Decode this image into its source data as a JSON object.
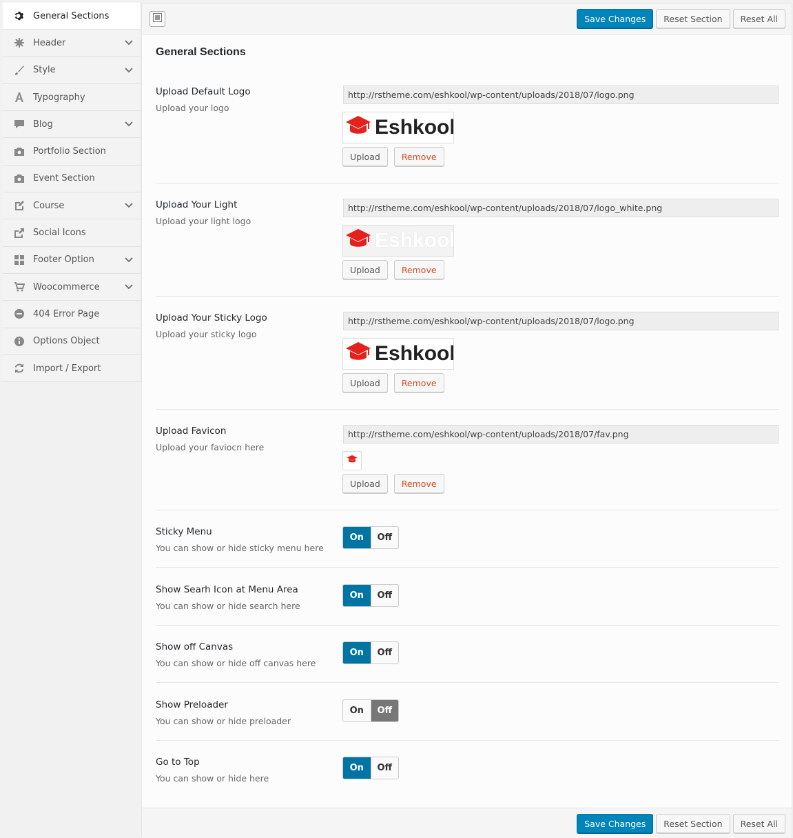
{
  "sidebar": {
    "items": [
      {
        "label": "General Sections",
        "icon": "gear-icon"
      },
      {
        "label": "Header",
        "icon": "cog-icon"
      },
      {
        "label": "Style",
        "icon": "brush-icon"
      },
      {
        "label": "Typography",
        "icon": "font-icon"
      },
      {
        "label": "Blog",
        "icon": "comment-icon"
      },
      {
        "label": "Portfolio Section",
        "icon": "camera-icon"
      },
      {
        "label": "Event Section",
        "icon": "camera-icon"
      },
      {
        "label": "Course",
        "icon": "edit-icon"
      },
      {
        "label": "Social Icons",
        "icon": "share-icon"
      },
      {
        "label": "Footer Option",
        "icon": "grid-icon"
      },
      {
        "label": "Woocommerce",
        "icon": "cart-icon"
      },
      {
        "label": "404 Error Page",
        "icon": "minus-circle-icon"
      },
      {
        "label": "Options Object",
        "icon": "info-icon"
      },
      {
        "label": "Import / Export",
        "icon": "refresh-icon"
      }
    ]
  },
  "toolbar": {
    "save_label": "Save Changes",
    "reset_section_label": "Reset Section",
    "reset_all_label": "Reset All"
  },
  "main": {
    "title": "General Sections",
    "uploads": [
      {
        "label": "Upload Default Logo",
        "desc": "Upload your logo",
        "url": "http://rstheme.com/eshkool/wp-content/uploads/2018/07/logo.png",
        "preview": "Eshkool",
        "variant": "dark-text"
      },
      {
        "label": "Upload Your Light",
        "desc": "Upload your light logo",
        "url": "http://rstheme.com/eshkool/wp-content/uploads/2018/07/logo_white.png",
        "preview": "Eshkool",
        "variant": "light-text"
      },
      {
        "label": "Upload Your Sticky Logo",
        "desc": "Upload your sticky logo",
        "url": "http://rstheme.com/eshkool/wp-content/uploads/2018/07/logo.png",
        "preview": "Eshkool",
        "variant": "dark-text"
      },
      {
        "label": "Upload Favicon",
        "desc": "Upload your faviocn here",
        "url": "http://rstheme.com/eshkool/wp-content/uploads/2018/07/fav.png",
        "preview": "",
        "variant": "favicon"
      }
    ],
    "upload_label": "Upload",
    "remove_label": "Remove",
    "switches": [
      {
        "label": "Sticky Menu",
        "desc": "You can show or hide sticky menu here",
        "value": "On"
      },
      {
        "label": "Show Searh Icon at Menu Area",
        "desc": "You can show or hide search here",
        "value": "On"
      },
      {
        "label": "Show off Canvas",
        "desc": "You can show or hide off canvas here",
        "value": "On"
      },
      {
        "label": "Show Preloader",
        "desc": "You can show or hide preloader",
        "value": "Off"
      },
      {
        "label": "Go to Top",
        "desc": "You can show or hide here",
        "value": "On"
      }
    ],
    "on_label": "On",
    "off_label": "Off"
  },
  "colors": {
    "primary": "#0085ba",
    "switch_on": "#0074a2",
    "switch_off": "#777777",
    "remove": "#d54e21",
    "logo_red": "#e5211b"
  }
}
